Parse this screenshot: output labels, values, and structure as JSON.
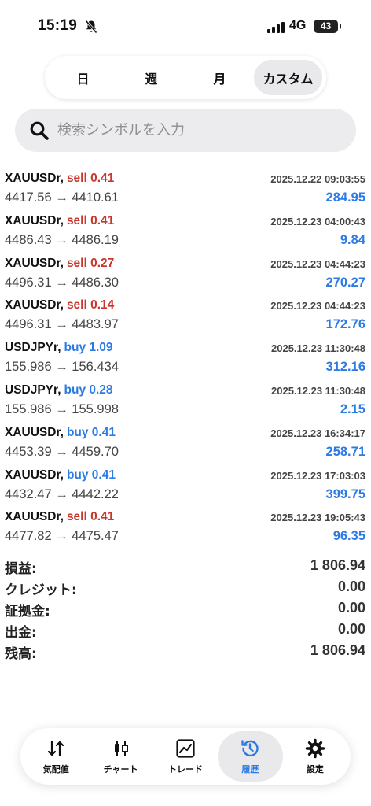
{
  "status_bar": {
    "time": "15:19",
    "network": "4G",
    "battery": "43"
  },
  "period_tabs": [
    {
      "label": "日",
      "active": false
    },
    {
      "label": "週",
      "active": false
    },
    {
      "label": "月",
      "active": false
    },
    {
      "label": "カスタム",
      "active": true
    }
  ],
  "search": {
    "placeholder": "検索シンボルを入力"
  },
  "trades": [
    {
      "symbol": "XAUUSDr,",
      "action": "sell 0.41",
      "side": "sell",
      "time": "2025.12.22 09:03:55",
      "prices": "4417.56 → 4410.61",
      "profit": "284.95"
    },
    {
      "symbol": "XAUUSDr,",
      "action": "sell 0.41",
      "side": "sell",
      "time": "2025.12.23 04:00:43",
      "prices": "4486.43 → 4486.19",
      "profit": "9.84"
    },
    {
      "symbol": "XAUUSDr,",
      "action": "sell 0.27",
      "side": "sell",
      "time": "2025.12.23 04:44:23",
      "prices": "4496.31 → 4486.30",
      "profit": "270.27"
    },
    {
      "symbol": "XAUUSDr,",
      "action": "sell 0.14",
      "side": "sell",
      "time": "2025.12.23 04:44:23",
      "prices": "4496.31 → 4483.97",
      "profit": "172.76"
    },
    {
      "symbol": "USDJPYr,",
      "action": "buy 1.09",
      "side": "buy",
      "time": "2025.12.23 11:30:48",
      "prices": "155.986 → 156.434",
      "profit": "312.16"
    },
    {
      "symbol": "USDJPYr,",
      "action": "buy 0.28",
      "side": "buy",
      "time": "2025.12.23 11:30:48",
      "prices": "155.986 → 155.998",
      "profit": "2.15"
    },
    {
      "symbol": "XAUUSDr,",
      "action": "buy 0.41",
      "side": "buy",
      "time": "2025.12.23 16:34:17",
      "prices": "4453.39 → 4459.70",
      "profit": "258.71"
    },
    {
      "symbol": "XAUUSDr,",
      "action": "buy 0.41",
      "side": "buy",
      "time": "2025.12.23 17:03:03",
      "prices": "4432.47 → 4442.22",
      "profit": "399.75"
    },
    {
      "symbol": "XAUUSDr,",
      "action": "sell 0.41",
      "side": "sell",
      "time": "2025.12.23 19:05:43",
      "prices": "4477.82 → 4475.47",
      "profit": "96.35"
    }
  ],
  "summary": [
    {
      "label": "損益:",
      "value": "1 806.94"
    },
    {
      "label": "クレジット:",
      "value": "0.00"
    },
    {
      "label": "証拠金:",
      "value": "0.00"
    },
    {
      "label": "出金:",
      "value": "0.00"
    },
    {
      "label": "残高:",
      "value": "1 806.94"
    }
  ],
  "tabbar": [
    {
      "label": "気配値",
      "icon": "quotes-icon",
      "active": false
    },
    {
      "label": "チャート",
      "icon": "chart-icon",
      "active": false
    },
    {
      "label": "トレード",
      "icon": "trade-icon",
      "active": false
    },
    {
      "label": "履歴",
      "icon": "history-icon",
      "active": true
    },
    {
      "label": "設定",
      "icon": "settings-icon",
      "active": false
    }
  ],
  "colors": {
    "sell": "#c8372d",
    "buy": "#2c7be5",
    "profit": "#2c7be5",
    "active_tab_label": "#2c7be5"
  }
}
